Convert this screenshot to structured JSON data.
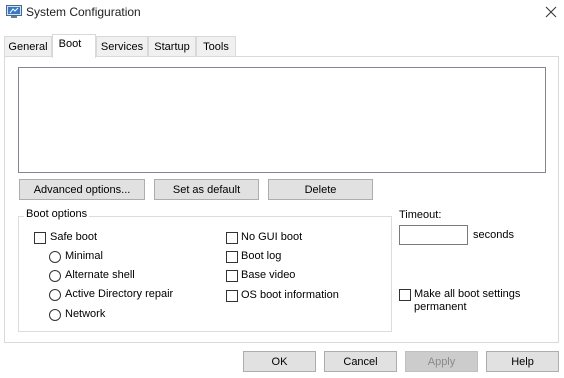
{
  "window": {
    "title": "System Configuration"
  },
  "tabs": [
    {
      "label": "General"
    },
    {
      "label": "Boot"
    },
    {
      "label": "Services"
    },
    {
      "label": "Startup"
    },
    {
      "label": "Tools"
    }
  ],
  "active_tab": "Boot",
  "os_list": {
    "items": []
  },
  "buttons": {
    "advanced": "Advanced options...",
    "set_default": "Set as default",
    "delete": "Delete",
    "ok": "OK",
    "cancel": "Cancel",
    "apply": "Apply",
    "help": "Help"
  },
  "boot_options": {
    "label": "Boot options",
    "safe_boot": {
      "label": "Safe boot",
      "checked": false
    },
    "radios": [
      {
        "label": "Minimal",
        "selected": false
      },
      {
        "label": "Alternate shell",
        "selected": false
      },
      {
        "label": "Active Directory repair",
        "selected": false
      },
      {
        "label": "Network",
        "selected": false
      }
    ],
    "right_checks": [
      {
        "label": "No GUI boot",
        "checked": false
      },
      {
        "label": "Boot log",
        "checked": false
      },
      {
        "label": "Base video",
        "checked": false
      },
      {
        "label": "OS boot information",
        "checked": false
      }
    ]
  },
  "timeout": {
    "label": "Timeout:",
    "value": "",
    "unit": "seconds"
  },
  "make_permanent": {
    "label_line1": "Make all boot settings",
    "label_line2": "permanent",
    "checked": false
  }
}
